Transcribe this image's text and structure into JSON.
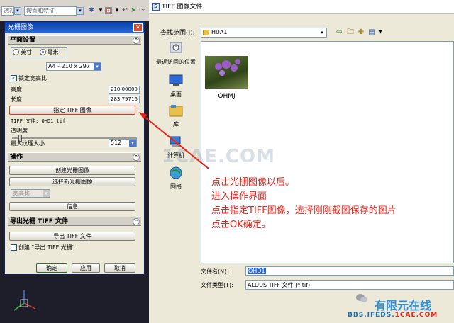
{
  "app": {
    "toolbar": {
      "combo1": "透视",
      "combo2": "按面和特征"
    }
  },
  "raster_panel": {
    "title": "光栅图像",
    "sections": {
      "plane": "平面设置",
      "ops": "操作",
      "export": "导出光栅 TIFF 文件"
    },
    "units": {
      "inch": "英寸",
      "mm": "毫米",
      "selected": "毫米"
    },
    "paper_size": "A4 - 210 x 297",
    "lock_ratio": "锁定宽高比",
    "height_label": "高度",
    "height_value": "210.00000",
    "length_label": "长度",
    "length_value": "283.79716",
    "specify_tiff_button": "指定 TIFF 图像",
    "tiff_file_label": "TIFF 文件: QHD1.tif",
    "transparency_label": "透明度",
    "transparency_value": 0.05,
    "max_texture_label": "最大纹理大小",
    "max_texture_value": "512",
    "create_raster_button": "创建光栅图像",
    "select_new_raster_button": "选择新光栅图像",
    "aspect_select": "宽高比",
    "info_button": "信息",
    "export_tiff_button": "导出 TIFF 文件",
    "create_export_check": "创建 \"导出 TIFF 光栅\"",
    "ok_button": "确定",
    "apply_button": "应用",
    "cancel_button": "取消"
  },
  "file_dialog": {
    "title": "TIFF 图像文件",
    "look_in_label": "查找范围(I):",
    "look_in_value": "HUA1",
    "places": [
      {
        "label": "最近访问的位置",
        "icon": "recent-places-icon"
      },
      {
        "label": "桌面",
        "icon": "desktop-icon"
      },
      {
        "label": "库",
        "icon": "library-icon"
      },
      {
        "label": "计算机",
        "icon": "computer-icon"
      },
      {
        "label": "网络",
        "icon": "network-icon"
      }
    ],
    "file_item_name": "QHMJ",
    "file_name_label": "文件名(N):",
    "file_name_value": "QHD1",
    "file_type_label": "文件类型(T):",
    "file_type_value": "ALDUS TIFF 文件 (*.tif)"
  },
  "annotation": {
    "lines": [
      "点击光栅图像以后。",
      "进入操作界面",
      "点击指定TIFF图像，选择刚刚截图保存的图片",
      "点击OK确定。"
    ],
    "color": "#e8241a"
  },
  "watermark": "1CAE.COM",
  "logo": {
    "name": "有限元在线",
    "site_prefix": "BBS.IFEDS.",
    "site_suffix": "1CAE.COM"
  }
}
